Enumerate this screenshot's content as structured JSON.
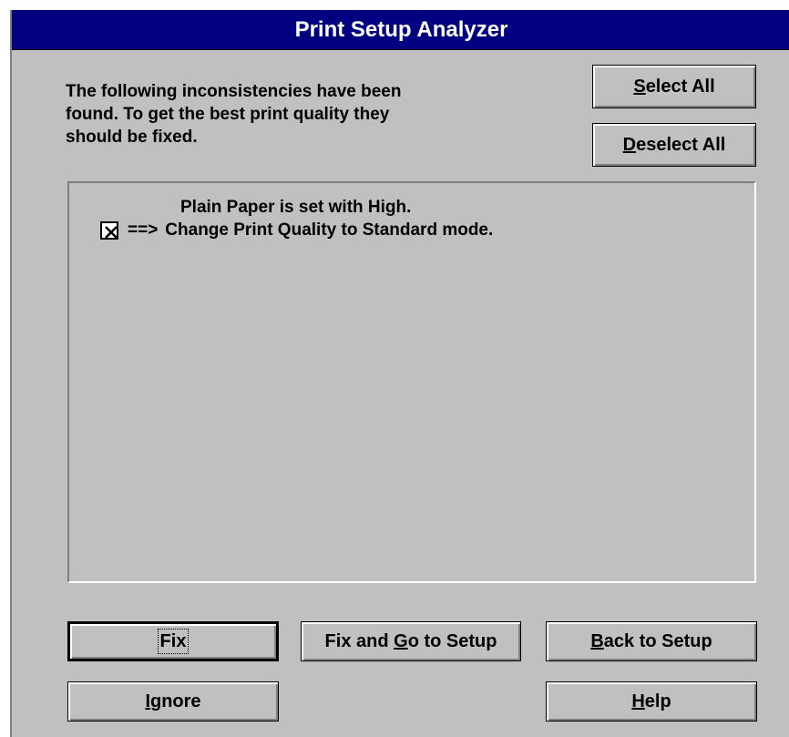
{
  "window": {
    "title": "Print Setup Analyzer"
  },
  "description": {
    "line1": "The following inconsistencies have been",
    "line2": "found. To get the best print quality they",
    "line3": "should be fixed."
  },
  "buttons": {
    "select_all": {
      "mnemonic": "S",
      "rest": "elect All"
    },
    "deselect_all": {
      "mnemonic": "D",
      "rest": "eselect All"
    },
    "fix": {
      "label": "Fix"
    },
    "fix_and_go": {
      "before": "Fix and ",
      "mnemonic": "G",
      "rest": "o to Setup"
    },
    "back_to_setup": {
      "mnemonic": "B",
      "rest": "ack to Setup"
    },
    "ignore": {
      "mnemonic": "I",
      "rest": "gnore"
    },
    "help": {
      "mnemonic": "H",
      "rest": "elp"
    }
  },
  "items": [
    {
      "problem": "Plain Paper is set with High.",
      "arrow": "==>",
      "fix": "Change Print Quality to Standard mode.",
      "checked": true
    }
  ]
}
